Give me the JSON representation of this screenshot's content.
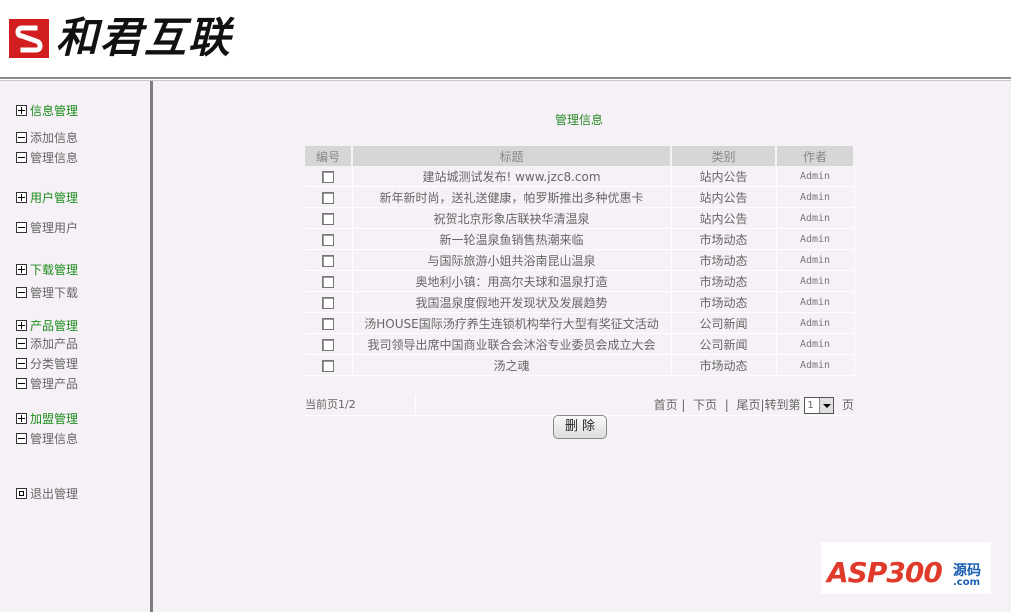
{
  "header": {
    "logo_text": "和君互联"
  },
  "sidebar": {
    "groups": [
      {
        "label": "信息管理",
        "items": [
          "添加信息",
          "管理信息"
        ]
      },
      {
        "label": "用户管理",
        "items": [
          "管理用户"
        ]
      },
      {
        "label": "下载管理",
        "items": [
          "管理下载"
        ]
      },
      {
        "label": "产品管理",
        "items": [
          "添加产品",
          "分类管理",
          "管理产品"
        ]
      },
      {
        "label": "加盟管理",
        "items": [
          "管理信息"
        ]
      }
    ],
    "logout_label": "退出管理"
  },
  "main": {
    "title": "管理信息",
    "table": {
      "headers": [
        "编号",
        "标题",
        "类别",
        "作者"
      ],
      "rows": [
        {
          "title": "建站城测试发布! www.jzc8.com",
          "category": "站内公告",
          "author": "Admin"
        },
        {
          "title": "新年新时尚，送礼送健康，帕罗斯推出多种优惠卡",
          "category": "站内公告",
          "author": "Admin"
        },
        {
          "title": "祝贺北京形象店联袂华清温泉",
          "category": "站内公告",
          "author": "Admin"
        },
        {
          "title": "新一轮温泉鱼销售热潮来临",
          "category": "市场动态",
          "author": "Admin"
        },
        {
          "title": "与国际旅游小姐共浴南昆山温泉",
          "category": "市场动态",
          "author": "Admin"
        },
        {
          "title": "奥地利小镇：用高尔夫球和温泉打造",
          "category": "市场动态",
          "author": "Admin"
        },
        {
          "title": "我国温泉度假地开发现状及发展趋势",
          "category": "市场动态",
          "author": "Admin"
        },
        {
          "title": "汤HOUSE国际汤疗养生连锁机构举行大型有奖征文活动",
          "category": "公司新闻",
          "author": "Admin"
        },
        {
          "title": "我司领导出席中国商业联合会沐浴专业委员会成立大会",
          "category": "公司新闻",
          "author": "Admin"
        },
        {
          "title": "汤之魂",
          "category": "市场动态",
          "author": "Admin"
        }
      ]
    },
    "pager": {
      "current": "当前页1/2",
      "first": "首页",
      "prev": "下页",
      "last": "尾页",
      "goto": "转到第",
      "page_value": "1",
      "page_unit": "页"
    },
    "delete_label": "删除"
  },
  "watermark": {
    "text": "ASP300",
    "sub": "源码",
    "com": ".com"
  },
  "colors": {
    "group_green": "#1b8d1b",
    "bg": "#f6f1f6",
    "header_cell": "#d6d6d6",
    "logo_red": "#d21e1e"
  }
}
